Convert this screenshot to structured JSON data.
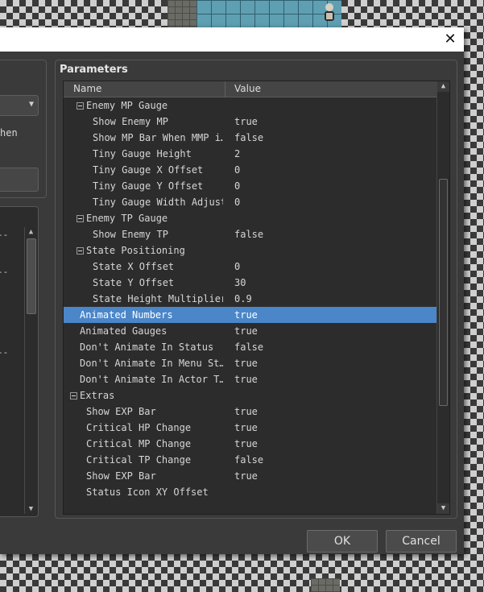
{
  "dialog": {
    "close_glyph": "✕",
    "params_title": "Parameters",
    "ok_label": "OK",
    "cancel_label": "Cancel"
  },
  "left_panel": {
    "partial_text": "hen",
    "dash": "--"
  },
  "table": {
    "columns": {
      "name": "Name",
      "value": "Value"
    },
    "scroll_position": 0.47,
    "rows": [
      {
        "name": "Enemy MP Gauge",
        "value": "",
        "level": 1,
        "expander": true
      },
      {
        "name": "Show Enemy MP",
        "value": "true",
        "level": 2
      },
      {
        "name": "Show MP Bar When MMP i…",
        "value": "false",
        "level": 2
      },
      {
        "name": "Tiny Gauge Height",
        "value": "2",
        "level": 2
      },
      {
        "name": "Tiny Gauge X Offset",
        "value": "0",
        "level": 2
      },
      {
        "name": "Tiny Gauge Y Offset",
        "value": "0",
        "level": 2
      },
      {
        "name": "Tiny Gauge Width Adjust",
        "value": "0",
        "level": 2
      },
      {
        "name": "Enemy TP Gauge",
        "value": "",
        "level": 1,
        "expander": true
      },
      {
        "name": "Show Enemy TP",
        "value": "false",
        "level": 2
      },
      {
        "name": "State Positioning",
        "value": "",
        "level": 1,
        "expander": true
      },
      {
        "name": "State X Offset",
        "value": "0",
        "level": 2
      },
      {
        "name": "State Y Offset",
        "value": "30",
        "level": 2
      },
      {
        "name": "State Height Multiplier",
        "value": "0.9",
        "level": 2
      },
      {
        "name": "Animated Numbers",
        "value": "true",
        "level": 0,
        "selected": true
      },
      {
        "name": "Animated Gauges",
        "value": "true",
        "level": 0
      },
      {
        "name": "Don't Animate In Status",
        "value": "false",
        "level": 0
      },
      {
        "name": "Don't Animate In Menu St…",
        "value": "true",
        "level": 0
      },
      {
        "name": "Don't Animate In Actor T…",
        "value": "true",
        "level": 0
      },
      {
        "name": "Extras",
        "value": "",
        "level": 0,
        "expander": true
      },
      {
        "name": "Show EXP Bar",
        "value": "true",
        "level": 1
      },
      {
        "name": "Critical HP Change",
        "value": "true",
        "level": 1
      },
      {
        "name": "Critical MP Change",
        "value": "true",
        "level": 1
      },
      {
        "name": "Critical TP Change",
        "value": "false",
        "level": 1
      },
      {
        "name": "Show EXP Bar",
        "value": "true",
        "level": 1
      },
      {
        "name": "Status Icon XY Offset",
        "value": "",
        "level": 1
      }
    ]
  },
  "colors": {
    "selection": "#4a86c8",
    "panel_bg": "#3a3a3a",
    "table_bg": "#2c2c2c"
  }
}
